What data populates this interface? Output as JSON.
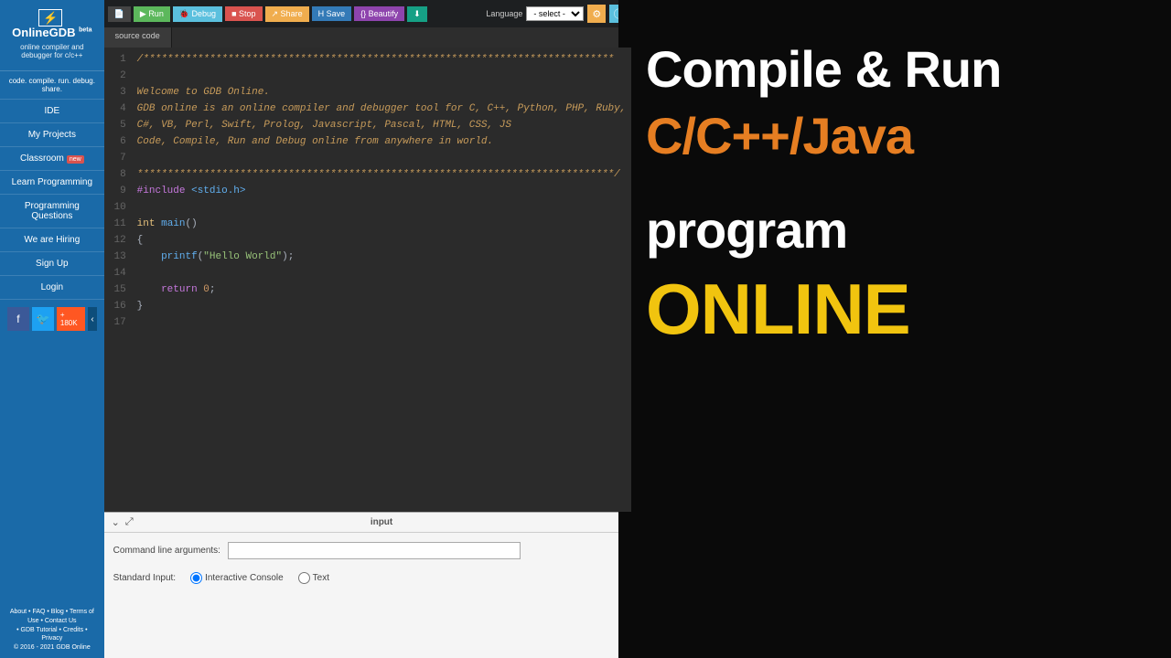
{
  "sidebar": {
    "logo_title": "OnlineGDB",
    "logo_beta": "beta",
    "logo_sub": "online compiler and debugger for c/c++",
    "share_text": "code. compile. run. debug. share.",
    "items": [
      {
        "label": "IDE"
      },
      {
        "label": "My Projects"
      },
      {
        "label": "Classroom",
        "new": "new"
      },
      {
        "label": "Learn Programming"
      },
      {
        "label": "Programming Questions"
      },
      {
        "label": "We are Hiring"
      },
      {
        "label": "Sign Up"
      },
      {
        "label": "Login"
      }
    ],
    "social_yt": "+ 180K",
    "footer1": "About • FAQ • Blog • Terms of Use • Contact Us",
    "footer2": "• GDB Tutorial • Credits • Privacy",
    "footer3": "© 2016 - 2021 GDB Online"
  },
  "toolbar": {
    "new": "",
    "run": "▶ Run",
    "debug": "🐞 Debug",
    "stop": "■ Stop",
    "share": "↗ Share",
    "save": "H Save",
    "beautify": "{} Beautify",
    "download": "⬇",
    "lang_label": "Language",
    "lang_value": "- select -"
  },
  "tab": {
    "label": "source code"
  },
  "code": {
    "lines": [
      "/******************************************************************************",
      "",
      "Welcome to GDB Online.",
      "GDB online is an online compiler and debugger tool for C, C++, Python, PHP, Ruby,",
      "C#, VB, Perl, Swift, Prolog, Javascript, Pascal, HTML, CSS, JS",
      "Code, Compile, Run and Debug online from anywhere in world.",
      "",
      "*******************************************************************************/",
      "#include <stdio.h>",
      "",
      "int main()",
      "{",
      "    printf(\"Hello World\");",
      "",
      "    return 0;",
      "}",
      ""
    ]
  },
  "input_panel": {
    "title": "input",
    "cmd_label": "Command line arguments:",
    "cmd_value": "",
    "stdin_label": "Standard Input:",
    "opt_interactive": "Interactive Console",
    "opt_text": "Text"
  },
  "promo": {
    "l1": "Compile & Run",
    "l2": "C/C++/Java",
    "l3": "program",
    "l4": "ONLINE"
  }
}
